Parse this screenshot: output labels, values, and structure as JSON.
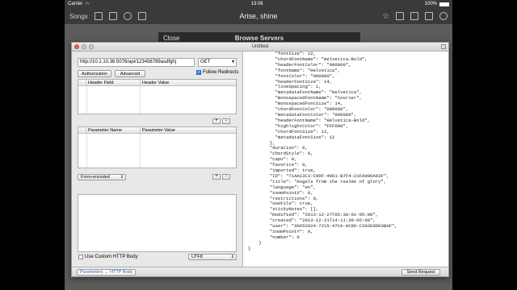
{
  "statusbar": {
    "carrier": "Carrier",
    "time": "13:06",
    "battery": "100%"
  },
  "appbar": {
    "songs_label": "Songs",
    "title": "Arise, shine"
  },
  "modal": {
    "close_label": "Close",
    "title": "Browse Servers"
  },
  "window": {
    "title": "Untitled"
  },
  "request": {
    "url": "http://10.1.10.36:5076/api/123456789asdfghj",
    "method": "GET",
    "authorization_label": "Authorization",
    "advanced_label": "Advanced",
    "follow_redirects_label": "Follow Redirects",
    "follow_redirects_checked": true,
    "header_table": {
      "col1": "Header Field",
      "col2": "Header Value"
    },
    "param_table": {
      "col1": "Parameter Name",
      "col2": "Parameter Value"
    },
    "add_label": "+",
    "remove_label": "−",
    "encoding_select": "Form-encoded",
    "custom_body_label": "Use Custom HTTP Body",
    "charset_select": "UTF8",
    "tab_label": "Parameters ↔ HTTP Body",
    "send_label": "Send Request"
  },
  "response": {
    "lines": [
      "          \"fontSize\": 12,",
      "          \"chordFontName\": \"Helvetica-Bold\",",
      "          \"headerFontColor\": \"000000\",",
      "          \"fontName\": \"Helvetica\",",
      "          \"fontColor\": \"000000\",",
      "          \"headerFontSize\": 14,",
      "          \"lineSpacing\": 1,",
      "          \"metadataFontName\": \"Helvetica\",",
      "          \"monospacedFontName\": \"Courier\",",
      "          \"monospacedFontSize\": 14,",
      "          \"chordFontColor\": \"000000\",",
      "          \"metadataFontColor\": \"000000\",",
      "          \"headerFontName\": \"Helvetica-Bold\",",
      "          \"highlightColor\": \"FFF000\",",
      "          \"chordFontSize\": 12,",
      "          \"metadataFontSize\": 12",
      "        },",
      "        \"duration\": 0,",
      "        \"chordStyle\": 0,",
      "        \"capo\": 0,",
      "        \"favorite\": 0,",
      "        \"imported\": true,",
      "        \"ID\": \"71AA13C3-C9DF-4061-B7F4-21FA006A03F\",",
      "        \"title\": \"Angels from the realms of glory\",",
      "        \"language\": \"en\",",
      "        \"zoomPointX\": 0,",
      "        \"restrictions\": 0,",
      "        \"useFile\": true,",
      "        \"stickyNotes\": [],",
      "        \"modified\": \"2013-12-27T05:38:01-05:00\",",
      "        \"created\": \"2013-12-21T14:11:39-05:00\",",
      "        \"user\": \"36652024-7215-47CA-AC8D-C302E0D03BAF\",",
      "        \"zoomPointY\": 0,",
      "        \"number\": 0",
      "    }",
      "}"
    ]
  }
}
